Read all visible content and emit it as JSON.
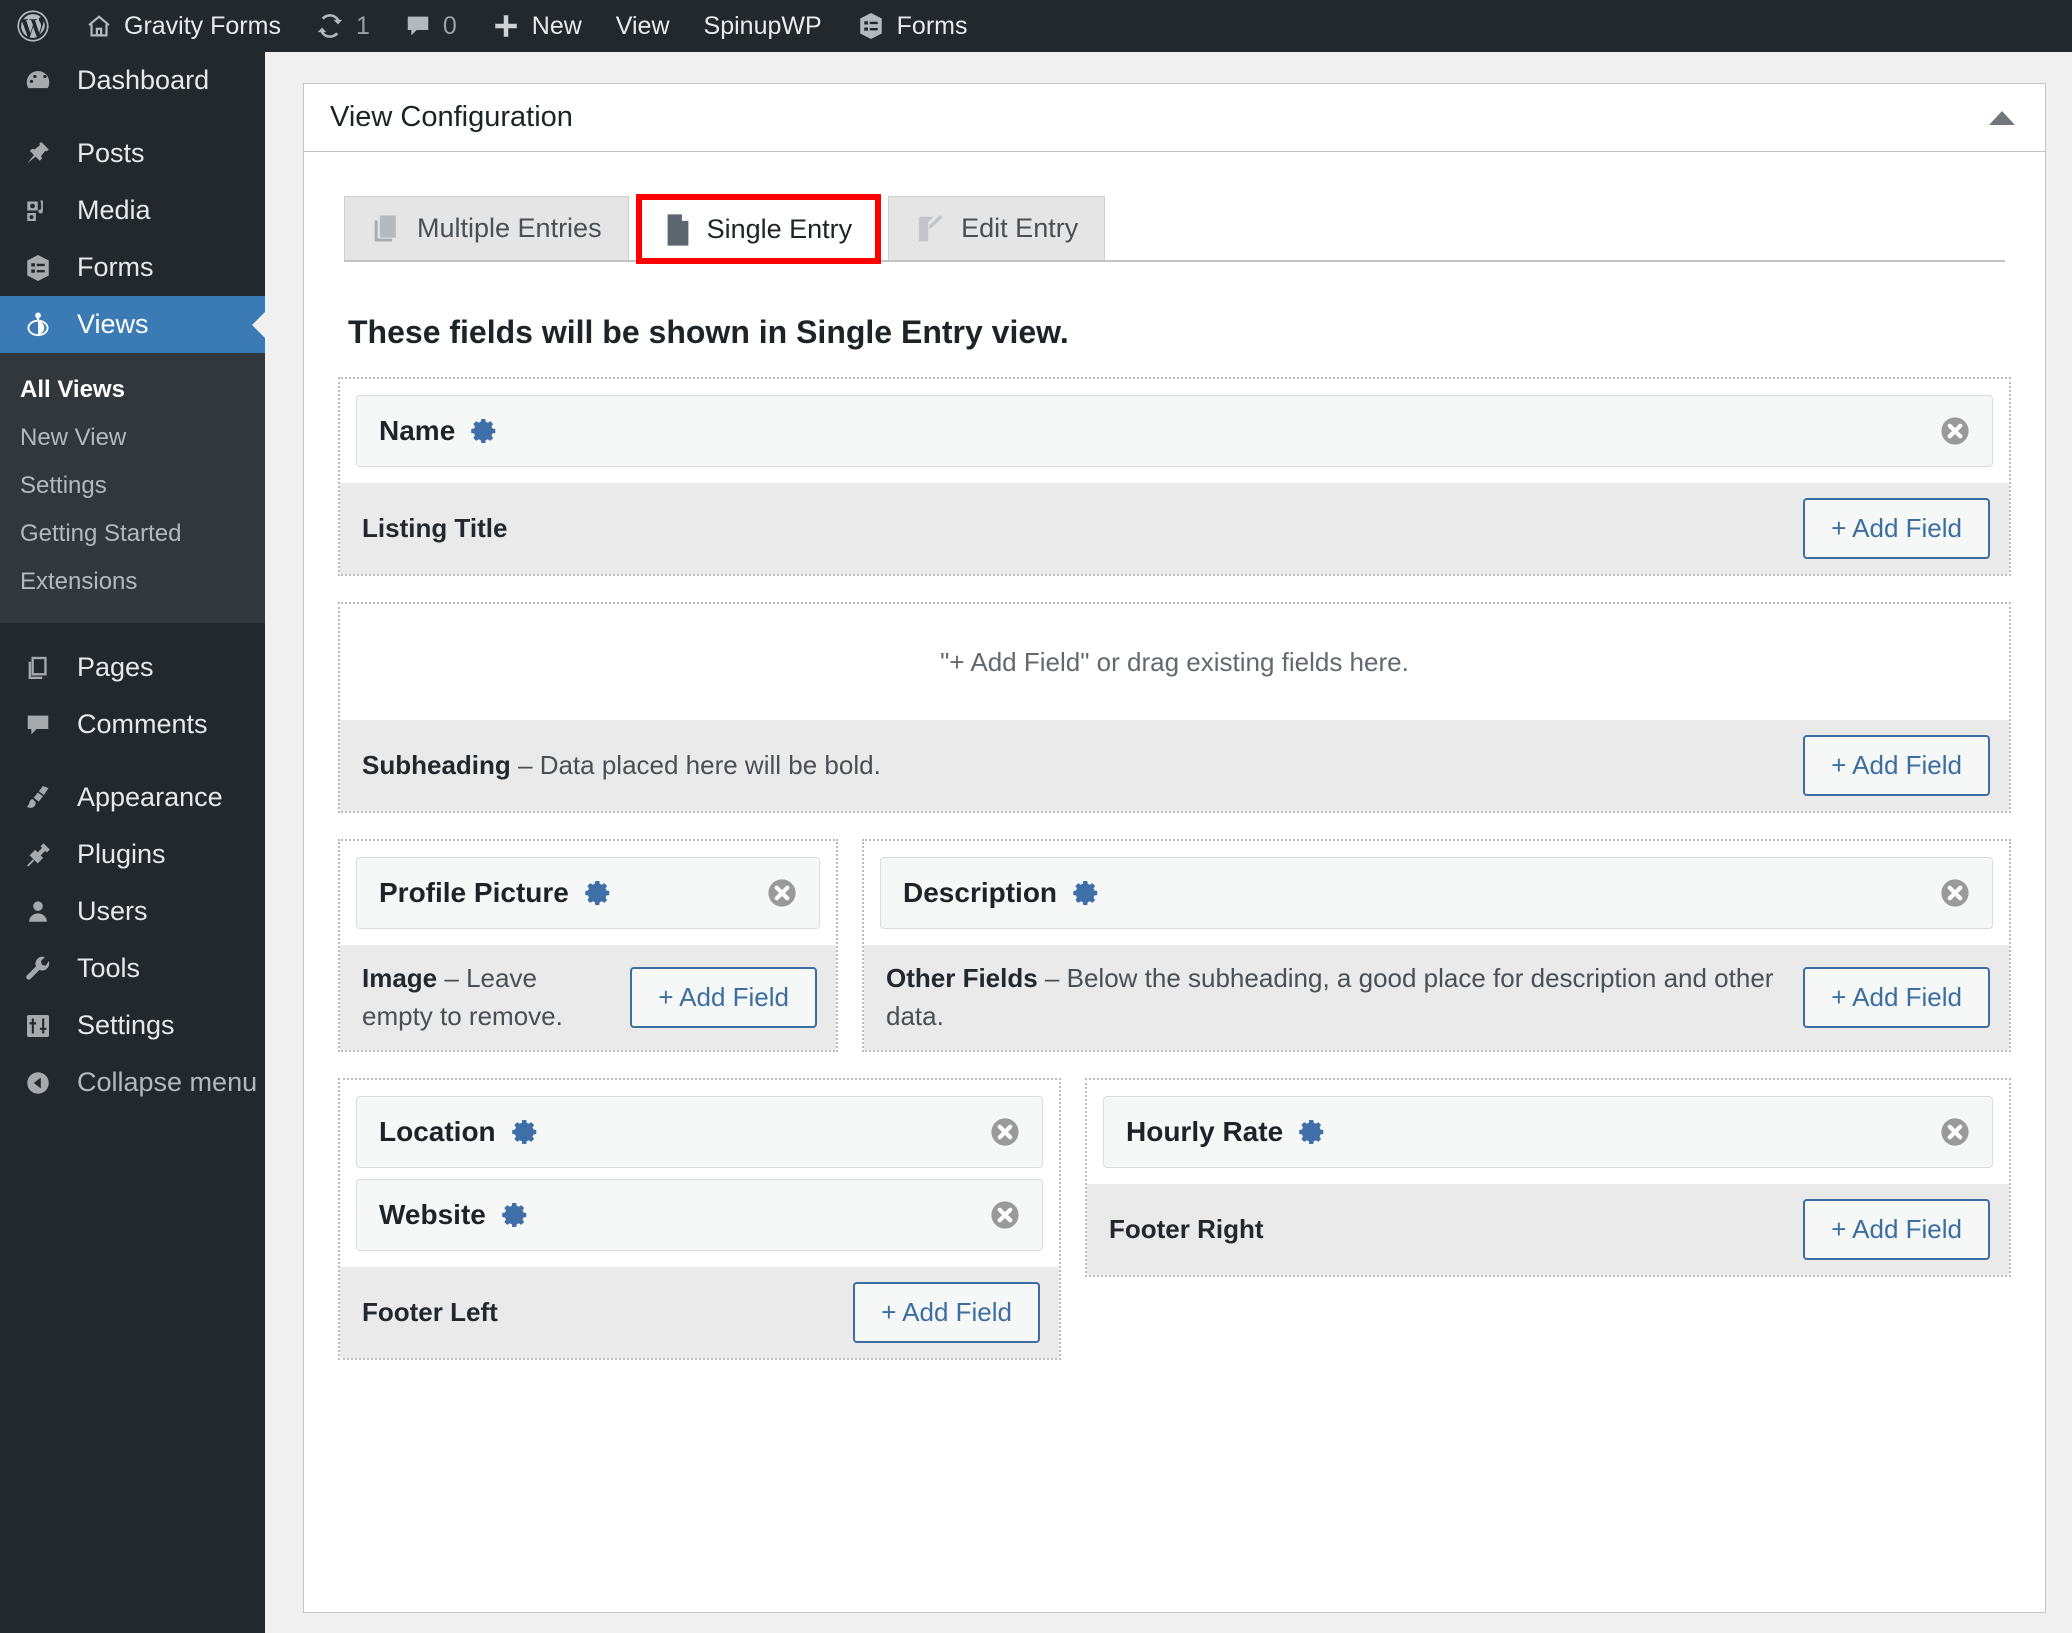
{
  "adminbar": {
    "items": [
      {
        "icon": "wordpress-logo-icon",
        "label": ""
      },
      {
        "icon": "home-icon",
        "label": "Gravity Forms"
      },
      {
        "icon": "updates-icon",
        "label": "1"
      },
      {
        "icon": "comment-bubble-icon",
        "label": "0"
      },
      {
        "icon": "plus-icon",
        "label": "New"
      },
      {
        "icon": "",
        "label": "View"
      },
      {
        "icon": "",
        "label": "SpinupWP"
      },
      {
        "icon": "forms-icon",
        "label": "Forms"
      }
    ]
  },
  "sidebar": {
    "items": [
      {
        "label": "Dashboard",
        "icon": "dashboard-icon"
      },
      {
        "label": "Posts",
        "icon": "pin-icon"
      },
      {
        "label": "Media",
        "icon": "media-icon"
      },
      {
        "label": "Forms",
        "icon": "forms-icon"
      },
      {
        "label": "Views",
        "icon": "views-icon",
        "active": true
      },
      {
        "label": "Pages",
        "icon": "pages-icon"
      },
      {
        "label": "Comments",
        "icon": "comment-bubble-icon"
      },
      {
        "label": "Appearance",
        "icon": "paintbrush-icon"
      },
      {
        "label": "Plugins",
        "icon": "plug-icon"
      },
      {
        "label": "Users",
        "icon": "user-icon"
      },
      {
        "label": "Tools",
        "icon": "wrench-icon"
      },
      {
        "label": "Settings",
        "icon": "sliders-icon"
      }
    ],
    "views_submenu": [
      {
        "label": "All Views",
        "current": true
      },
      {
        "label": "New View"
      },
      {
        "label": "Settings"
      },
      {
        "label": "Getting Started"
      },
      {
        "label": "Extensions"
      }
    ],
    "collapse": {
      "label": "Collapse menu",
      "icon": "collapse-icon"
    }
  },
  "panel": {
    "title": "View Configuration",
    "toggle_icon": "triangle-up-icon"
  },
  "tabs": [
    {
      "label": "Multiple Entries",
      "icon": "stacked-pages-icon",
      "active": false
    },
    {
      "label": "Single Entry",
      "icon": "single-page-icon",
      "active": true,
      "highlighted": true
    },
    {
      "label": "Edit Entry",
      "icon": "page-pencil-icon",
      "active": false
    }
  ],
  "main": {
    "section_heading": "These fields will be shown in Single Entry view.",
    "add_field_label": "+ Add Field",
    "empty_zone_message": "\"+ Add Field\" or drag existing fields here.",
    "zones": {
      "title": {
        "fields": [
          {
            "label": "Name",
            "has_gear": true,
            "has_close": true
          }
        ],
        "foot_label": "Listing Title",
        "foot_desc": ""
      },
      "subheading": {
        "fields": [],
        "foot_label": "Subheading",
        "foot_desc": " – Data placed here will be bold."
      },
      "image": {
        "fields": [
          {
            "label": "Profile Picture",
            "has_gear": true,
            "has_close": true
          }
        ],
        "foot_label": "Image",
        "foot_desc": " – Leave empty to remove."
      },
      "other_fields": {
        "fields": [
          {
            "label": "Description",
            "has_gear": true,
            "has_close": true
          }
        ],
        "foot_label": "Other Fields",
        "foot_desc": " – Below the subheading, a good place for description and other data."
      },
      "footer_left": {
        "fields": [
          {
            "label": "Location",
            "has_gear": true,
            "has_close": true
          },
          {
            "label": "Website",
            "has_gear": true,
            "has_close": true
          }
        ],
        "foot_label": "Footer Left",
        "foot_desc": ""
      },
      "footer_right": {
        "fields": [
          {
            "label": "Hourly Rate",
            "has_gear": true,
            "has_close": true
          }
        ],
        "foot_label": "Footer Right",
        "foot_desc": ""
      }
    }
  },
  "colors": {
    "admin_dark": "#23282d",
    "submenu_dark": "#32373c",
    "active_blue": "#3b7bb5",
    "gear_blue": "#3f6fa8",
    "button_blue": "#3c6f9f",
    "highlight_red": "#ff0000",
    "page_bg": "#f0f0f1",
    "zone_foot_gray": "#eaeaea"
  }
}
